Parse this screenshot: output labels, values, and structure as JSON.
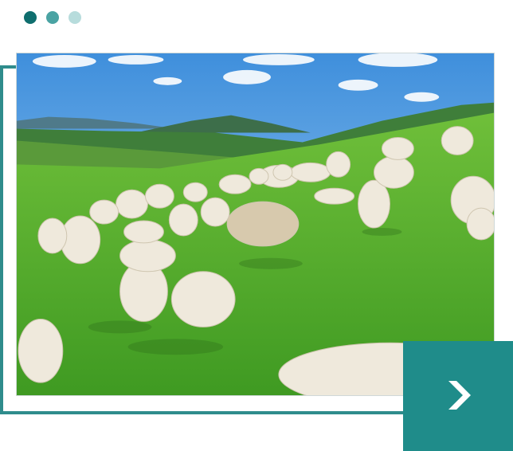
{
  "carousel": {
    "indicators": [
      {
        "state": "active",
        "color": "#0f6e6e"
      },
      {
        "state": "inactive",
        "color": "#4aa3a3"
      },
      {
        "state": "inactive",
        "color": "#b7dcdc"
      }
    ],
    "frame_color": "#2f8c8c",
    "next_button": {
      "icon": "chevron-right-icon",
      "color": "#1f8c8a"
    }
  },
  "photo": {
    "subject": "goats-grazing-on-green-hillside"
  }
}
